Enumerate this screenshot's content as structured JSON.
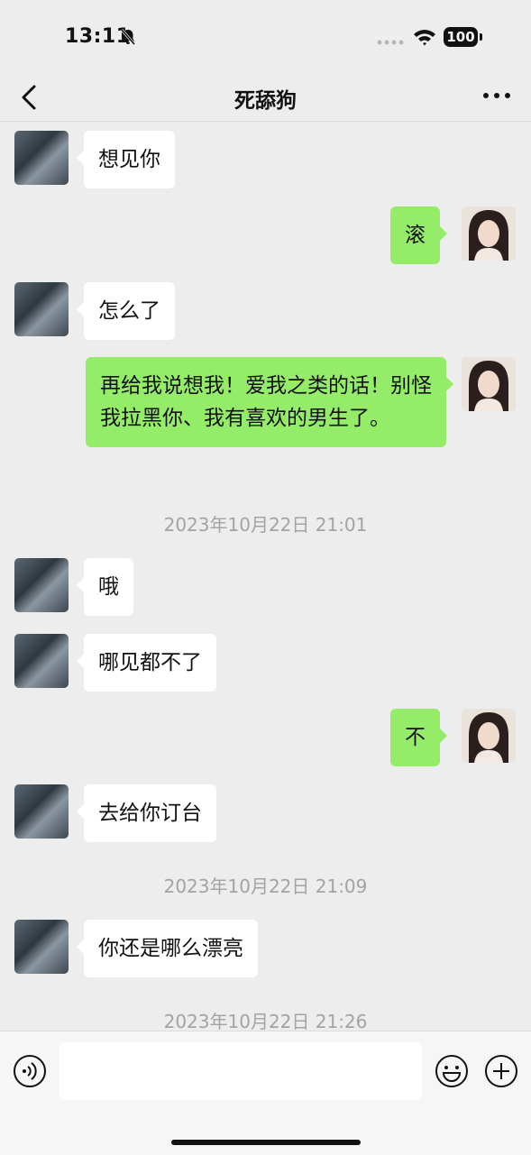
{
  "status_bar": {
    "time": "13:11",
    "battery": "100"
  },
  "header": {
    "title": "死舔狗"
  },
  "messages": [
    {
      "text": "想见你"
    },
    {
      "text": "滚"
    },
    {
      "text": "怎么了"
    },
    {
      "text": "再给我说想我！爱我之类的话！别怪我拉黑你、我有喜欢的男生了。"
    },
    {
      "text": "2023年10月22日 21:01"
    },
    {
      "text": "哦"
    },
    {
      "text": "哪见都不了"
    },
    {
      "text": "不"
    },
    {
      "text": "去给你订台"
    },
    {
      "text": "2023年10月22日 21:09"
    },
    {
      "text": "你还是哪么漂亮"
    },
    {
      "text": "2023年10月22日 21:26"
    }
  ],
  "input": {
    "value": ""
  },
  "colors": {
    "background": "#ededed",
    "incoming_bubble": "#ffffff",
    "outgoing_bubble": "#95ec69",
    "timestamp": "#a3a3a3"
  }
}
